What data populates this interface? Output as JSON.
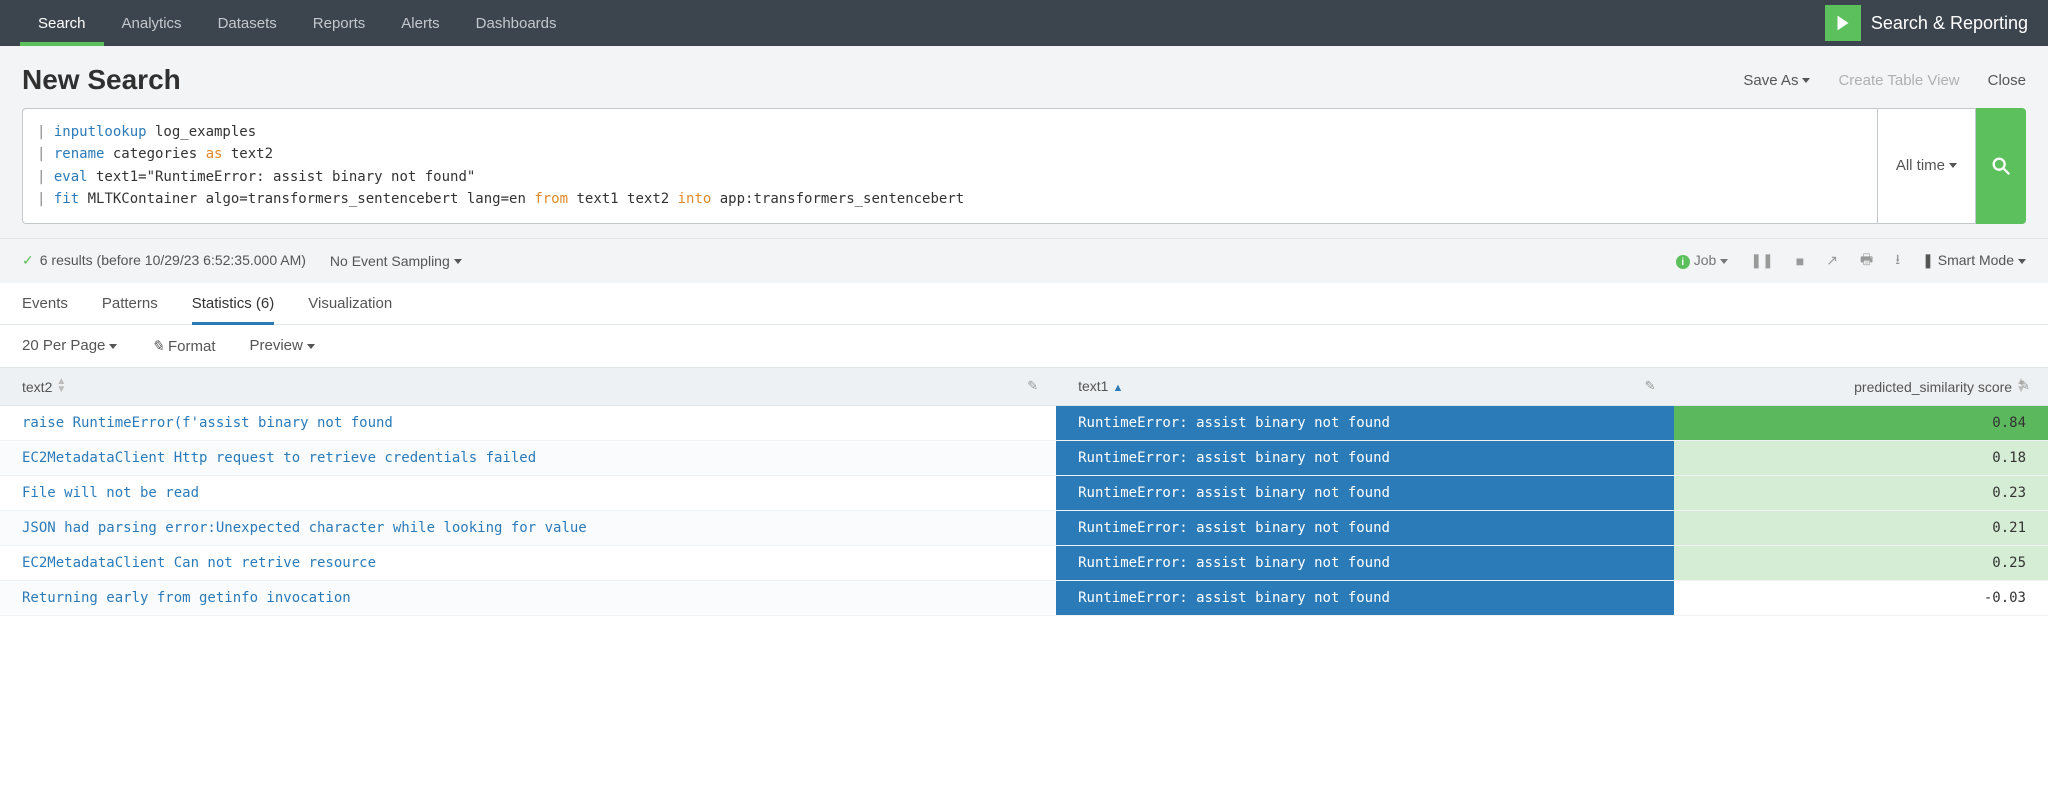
{
  "app": {
    "title": "Search & Reporting"
  },
  "nav": {
    "tabs": [
      {
        "label": "Search",
        "active": true
      },
      {
        "label": "Analytics"
      },
      {
        "label": "Datasets"
      },
      {
        "label": "Reports"
      },
      {
        "label": "Alerts"
      },
      {
        "label": "Dashboards"
      }
    ]
  },
  "page": {
    "title": "New Search",
    "actions": {
      "save_as": "Save As",
      "create_table_view": "Create Table View",
      "close": "Close"
    }
  },
  "search": {
    "tokens": [
      {
        "t": "pipe",
        "v": "| "
      },
      {
        "t": "blue",
        "v": "inputlookup"
      },
      {
        "t": "txt",
        "v": " log_examples\n"
      },
      {
        "t": "pipe",
        "v": "| "
      },
      {
        "t": "blue",
        "v": "rename"
      },
      {
        "t": "txt",
        "v": " categories "
      },
      {
        "t": "orange",
        "v": "as"
      },
      {
        "t": "txt",
        "v": " text2\n"
      },
      {
        "t": "pipe",
        "v": "| "
      },
      {
        "t": "blue",
        "v": "eval"
      },
      {
        "t": "txt",
        "v": " text1=\"RuntimeError: assist binary not found\"\n"
      },
      {
        "t": "pipe",
        "v": "| "
      },
      {
        "t": "blue",
        "v": "fit"
      },
      {
        "t": "txt",
        "v": " MLTKContainer algo=transformers_sentencebert lang=en "
      },
      {
        "t": "orange",
        "v": "from"
      },
      {
        "t": "txt",
        "v": " text1 text2 "
      },
      {
        "t": "orange",
        "v": "into"
      },
      {
        "t": "txt",
        "v": " app:transformers_sentencebert"
      }
    ],
    "time_picker": "All time"
  },
  "status": {
    "results": "6 results (before 10/29/23 6:52:35.000 AM)",
    "sampling": "No Event Sampling",
    "job": "Job",
    "mode": "Smart Mode"
  },
  "result_tabs": [
    {
      "label": "Events"
    },
    {
      "label": "Patterns"
    },
    {
      "label": "Statistics (6)",
      "active": true
    },
    {
      "label": "Visualization"
    }
  ],
  "table_toolbar": {
    "per_page": "20 Per Page",
    "format": "Format",
    "preview": "Preview"
  },
  "table": {
    "columns": [
      {
        "key": "text2",
        "label": "text2",
        "sort": "both"
      },
      {
        "key": "text1",
        "label": "text1",
        "sort": "asc"
      },
      {
        "key": "score",
        "label": "predicted_similarity score",
        "sort": "both",
        "align": "right"
      }
    ],
    "rows": [
      {
        "text2": "raise RuntimeError(f'assist binary not found",
        "text1": "RuntimeError: assist binary not found",
        "score": "0.84",
        "score_class": "score-bar-84"
      },
      {
        "text2": "EC2MetadataClient Http request to retrieve credentials failed",
        "text1": "RuntimeError: assist binary not found",
        "score": "0.18",
        "score_class": "score-bar-18"
      },
      {
        "text2": "File will not be read",
        "text1": "RuntimeError: assist binary not found",
        "score": "0.23",
        "score_class": "score-bar-23"
      },
      {
        "text2": "JSON had parsing error:Unexpected character while looking for value",
        "text1": "RuntimeError: assist binary not found",
        "score": "0.21",
        "score_class": "score-bar-21"
      },
      {
        "text2": "EC2MetadataClient Can not retrive resource",
        "text1": "RuntimeError: assist binary not found",
        "score": "0.25",
        "score_class": "score-bar-25"
      },
      {
        "text2": "Returning early from getinfo invocation",
        "text1": "RuntimeError: assist binary not found",
        "score": "-0.03",
        "score_class": "score-bar-neg"
      }
    ]
  }
}
